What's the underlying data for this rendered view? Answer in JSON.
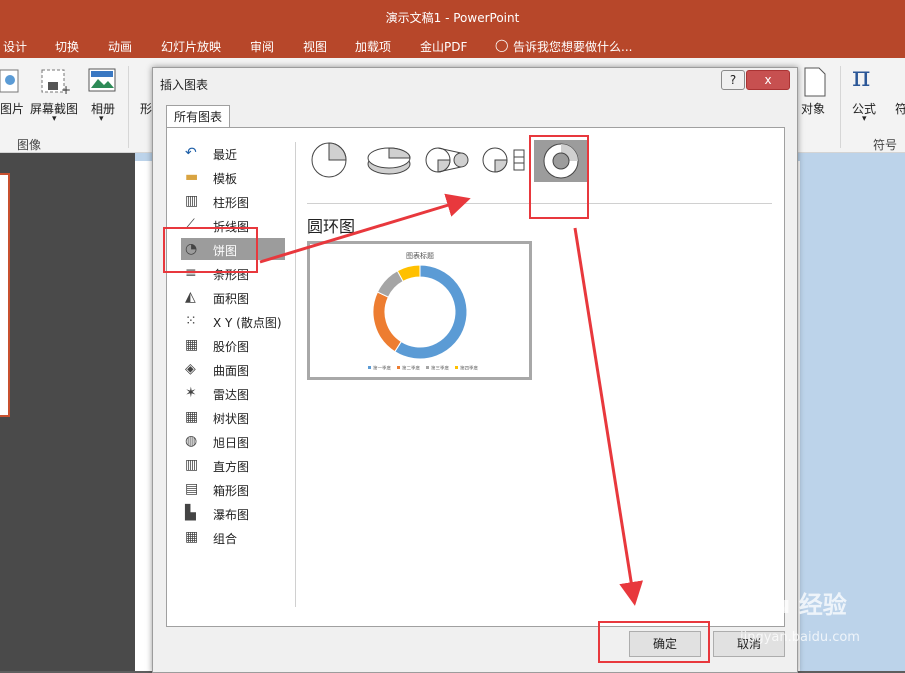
{
  "window": {
    "title": "演示文稿1 - PowerPoint"
  },
  "menu": {
    "items": [
      "设计",
      "切换",
      "动画",
      "幻灯片放映",
      "审阅",
      "视图",
      "加载项",
      "金山PDF"
    ],
    "tell_me": "告诉我您想要做什么..."
  },
  "ribbon": {
    "picture_label": "图片",
    "screenshot_label": "屏幕截图",
    "album_label": "相册",
    "shapes_partial": "形",
    "group_images": "图像",
    "object_label": "对象",
    "formula_label": "公式",
    "symbol_label": "符",
    "group_symbols": "符号"
  },
  "dialog": {
    "title": "插入图表",
    "help": "?",
    "close": "x",
    "tab_all": "所有图表",
    "categories": [
      {
        "label": "最近",
        "icon": "recent-icon"
      },
      {
        "label": "模板",
        "icon": "folder-icon"
      },
      {
        "label": "柱形图",
        "icon": "column-chart-icon"
      },
      {
        "label": "折线图",
        "icon": "line-chart-icon"
      },
      {
        "label": "饼图",
        "icon": "pie-chart-icon"
      },
      {
        "label": "条形图",
        "icon": "bar-chart-icon"
      },
      {
        "label": "面积图",
        "icon": "area-chart-icon"
      },
      {
        "label": "X Y (散点图)",
        "icon": "scatter-chart-icon"
      },
      {
        "label": "股价图",
        "icon": "stock-chart-icon"
      },
      {
        "label": "曲面图",
        "icon": "surface-chart-icon"
      },
      {
        "label": "雷达图",
        "icon": "radar-chart-icon"
      },
      {
        "label": "树状图",
        "icon": "treemap-chart-icon"
      },
      {
        "label": "旭日图",
        "icon": "sunburst-chart-icon"
      },
      {
        "label": "直方图",
        "icon": "histogram-chart-icon"
      },
      {
        "label": "箱形图",
        "icon": "box-whisker-chart-icon"
      },
      {
        "label": "瀑布图",
        "icon": "waterfall-chart-icon"
      },
      {
        "label": "组合",
        "icon": "combo-chart-icon"
      }
    ],
    "selected_category": "饼图",
    "subtypes": [
      "pie",
      "3d-pie",
      "pie-of-pie",
      "bar-of-pie",
      "doughnut"
    ],
    "selected_subtype": "doughnut",
    "subtype_title": "圆环图",
    "preview": {
      "chart_title": "图表标题",
      "legend": [
        "第一季度",
        "第二季度",
        "第三季度",
        "第四季度"
      ],
      "colors": [
        "#5b9bd5",
        "#ed7d31",
        "#a5a5a5",
        "#ffc000"
      ]
    },
    "ok": "确定",
    "cancel": "取消"
  },
  "watermark": {
    "brand": "Bai du 经验",
    "url": "jingyan.baidu.com"
  },
  "chart_data": {
    "type": "pie",
    "title": "图表标题",
    "categories": [
      "第一季度",
      "第二季度",
      "第三季度",
      "第四季度"
    ],
    "values": [
      59,
      23,
      10,
      8
    ]
  }
}
